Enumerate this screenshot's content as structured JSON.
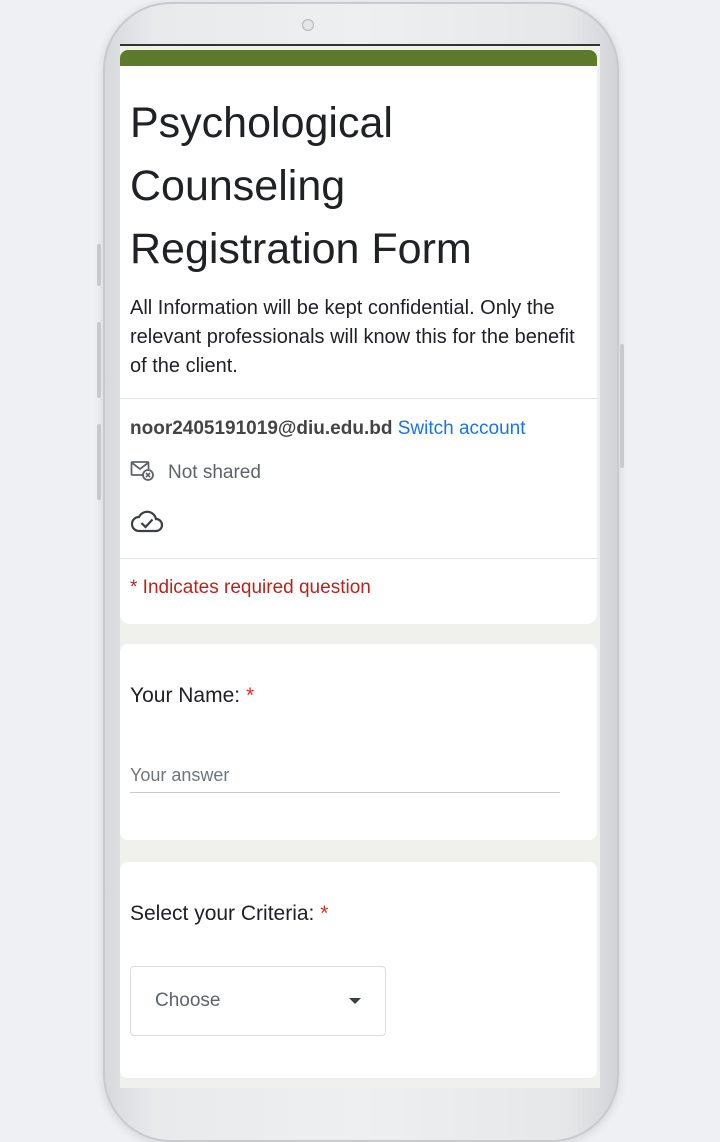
{
  "form": {
    "title": "Psychological Counseling Registration Form",
    "description": "All Information will be kept confidential. Only the relevant professionals will know this for the benefit of the client.",
    "accent_color": "#5b7a2a"
  },
  "account": {
    "email": "noor2405191019@diu.edu.bd",
    "switch_label": "Switch account",
    "not_shared_label": "Not shared"
  },
  "required_note": "* Indicates required question",
  "questions": [
    {
      "label": "Your Name:",
      "required_mark": "*",
      "placeholder": "Your answer"
    },
    {
      "label": "Select your Criteria:",
      "required_mark": "*",
      "selected": "Choose"
    }
  ],
  "icons": [
    "mail-not-shared-icon",
    "cloud-check-icon",
    "dropdown-caret-icon"
  ]
}
